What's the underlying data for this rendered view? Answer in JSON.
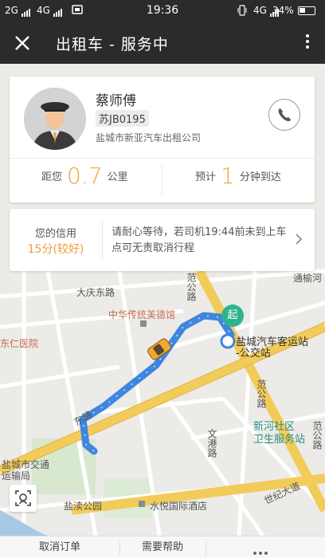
{
  "status_bar": {
    "left_signal_1": "2G",
    "left_signal_2": "4G",
    "time": "19:36",
    "right_network": "4G",
    "battery_percent": "34%"
  },
  "app_bar": {
    "title": "出租车 - 服务中",
    "close_icon": "close-icon",
    "more_icon": "more-vertical-icon"
  },
  "driver": {
    "name": "蔡师傅",
    "plate": "苏JB0195",
    "company": "盐城市新亚汽车出租公司",
    "phone_icon": "phone-icon"
  },
  "stats": {
    "distance_prefix": "距您",
    "distance_value": "0.7",
    "distance_unit": "公里",
    "eta_prefix": "预计",
    "eta_value": "1",
    "eta_unit": "分钟到达"
  },
  "credit": {
    "label": "您的信用",
    "score": "15分(较好)",
    "message": "请耐心等待，若司机19:44前未到上车点可无责取消行程"
  },
  "map": {
    "labels": {
      "dq_east": "大庆东路",
      "tongyu": "通榆河",
      "fan_gong_road": "范公路",
      "fan_gong_road_2": "范公路",
      "fan_gong_road_3": "范公路",
      "museum": "中华传统美德馆",
      "hospital": "东仁医院",
      "bus_station": "盐城汽车客运站",
      "bus_stop": "-公交站",
      "wengang": "文港路",
      "xinhe_1": "新河社区",
      "xinhe_2": "卫生服务站",
      "traffic_1": "盐城市交通",
      "traffic_2": "运输局",
      "park": "盐渎公园",
      "hotel": "水悦国际酒店",
      "century": "世纪大道",
      "west_road": "东路"
    },
    "start_marker": "起",
    "colors": {
      "route": "#4a90e2",
      "major_road": "#f2cc5b",
      "start_marker": "#2fb38f"
    }
  },
  "bottom_bar": {
    "cancel_order": "取消订单",
    "need_help": "需要帮助",
    "more_icon": "more-horizontal-icon"
  },
  "colors": {
    "accent_orange": "#f2a23c",
    "header_bg": "#2b2b2d"
  }
}
